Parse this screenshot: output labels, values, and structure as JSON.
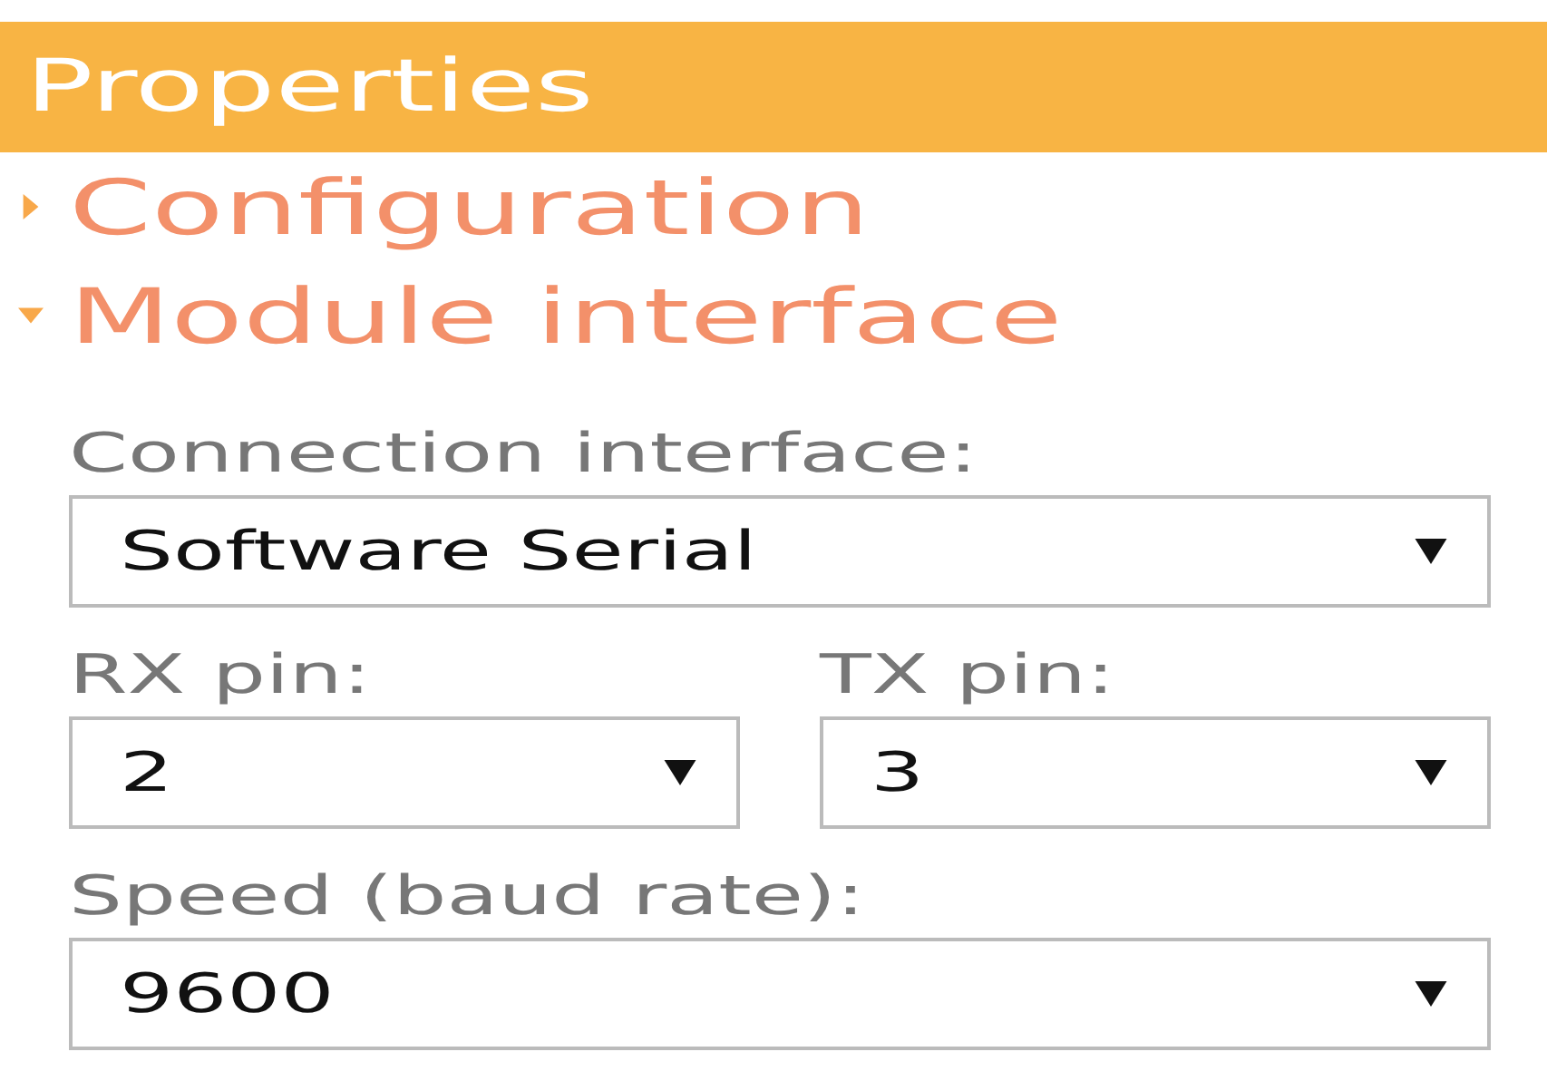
{
  "panel": {
    "title": "Properties"
  },
  "sections": [
    {
      "label": "Configuration",
      "expanded": false
    },
    {
      "label": "Module interface",
      "expanded": true,
      "rows": [
        [
          {
            "label": "Connection interface:",
            "value": "Software Serial"
          }
        ],
        [
          {
            "label": "RX pin:",
            "value": "2"
          },
          {
            "label": "TX pin:",
            "value": "3"
          }
        ],
        [
          {
            "label": "Speed (baud rate):",
            "value": "9600"
          }
        ]
      ]
    }
  ]
}
